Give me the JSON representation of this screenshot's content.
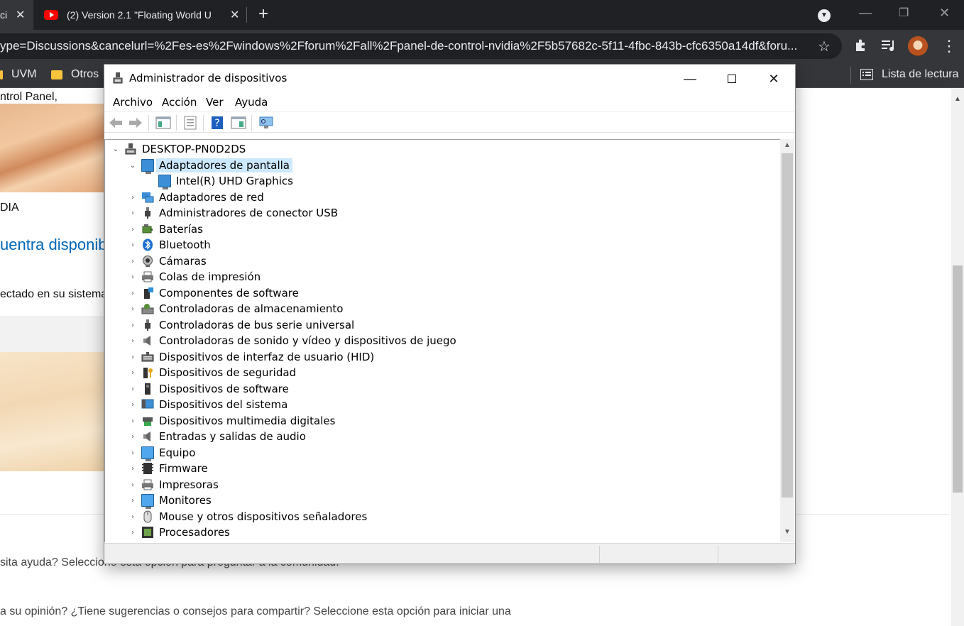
{
  "browser": {
    "tabs": [
      {
        "title": "ci",
        "close": "✕"
      },
      {
        "title": "(2) Version 2.1 \"Floating World U",
        "close": "✕"
      }
    ],
    "url": "ype=Discussions&cancelurl=%2Fes-es%2Fwindows%2Fforum%2Fall%2Fpanel-de-control-nvidia%2F5b57682c-5f11-4fbc-843b-cfc6350a14df&foru...",
    "bookmarks": [
      {
        "label": "UVM"
      },
      {
        "label": "Otros"
      }
    ],
    "reading_list": "Lista de lectura"
  },
  "webpage": {
    "line1": "ntrol Panel,",
    "line2": "DIA",
    "link": "uentra disponib",
    "line3": "ectado en su sistema",
    "footer1": "sita ayuda? Seleccione esta opción para preguntar a la comunidad.",
    "footer2": "a su opinión? ¿Tiene sugerencias o consejos para compartir? Seleccione esta opción para iniciar una"
  },
  "device_manager": {
    "title": "Administrador de dispositivos",
    "menu": [
      "Archivo",
      "Acción",
      "Ver",
      "Ayuda"
    ],
    "root": "DESKTOP-PN0D2DS",
    "expanded": {
      "label": "Adaptadores de pantalla",
      "children": [
        "Intel(R) UHD Graphics"
      ]
    },
    "categories": [
      "Adaptadores de red",
      "Administradores de conector USB",
      "Baterías",
      "Bluetooth",
      "Cámaras",
      "Colas de impresión",
      "Componentes de software",
      "Controladoras de almacenamiento",
      "Controladoras de bus serie universal",
      "Controladoras de sonido y vídeo y dispositivos de juego",
      "Dispositivos de interfaz de usuario (HID)",
      "Dispositivos de seguridad",
      "Dispositivos de software",
      "Dispositivos del sistema",
      "Dispositivos multimedia digitales",
      "Entradas y salidas de audio",
      "Equipo",
      "Firmware",
      "Impresoras",
      "Monitores",
      "Mouse y otros dispositivos señaladores",
      "Procesadores"
    ]
  },
  "colors": {
    "selection": "#cce8ff",
    "link": "#0067b8",
    "chrome_dark": "#202124",
    "chrome_toolbar": "#35363a"
  }
}
